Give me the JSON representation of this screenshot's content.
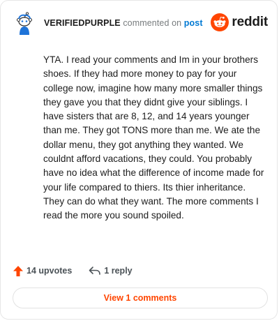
{
  "comment": {
    "username": "VERIFIEDPURPLE",
    "action_text": "commented on",
    "link_text": "post",
    "body": "YTA. I read your comments and Im in your brothers shoes. If they had more money to pay for your college now, imagine how many more smaller things they gave you that they didnt give your siblings. I have sisters that are 8, 12, and 14 years younger than me. They got TONS more than me. We ate the dollar menu, they got anything they wanted. We couldnt afford vacations, they could. You probably have no idea what the difference of income made for your life compared to thiers. Its thier inheritance. They can do what they want. The more comments I read the more you sound spoiled."
  },
  "brand": {
    "wordmark": "reddit",
    "icon": "reddit-alien-icon",
    "color": "#ff4500"
  },
  "avatar": {
    "icon": "snoo-avatar-icon",
    "accent": "#1e73d8"
  },
  "actions": {
    "upvotes_label": "14 upvotes",
    "upvote_icon": "upvote-arrow-icon",
    "upvote_color": "#ff4500",
    "reply_label": "1 reply",
    "reply_icon": "reply-arrow-icon"
  },
  "footer": {
    "view_comments_label": "View 1 comments"
  }
}
